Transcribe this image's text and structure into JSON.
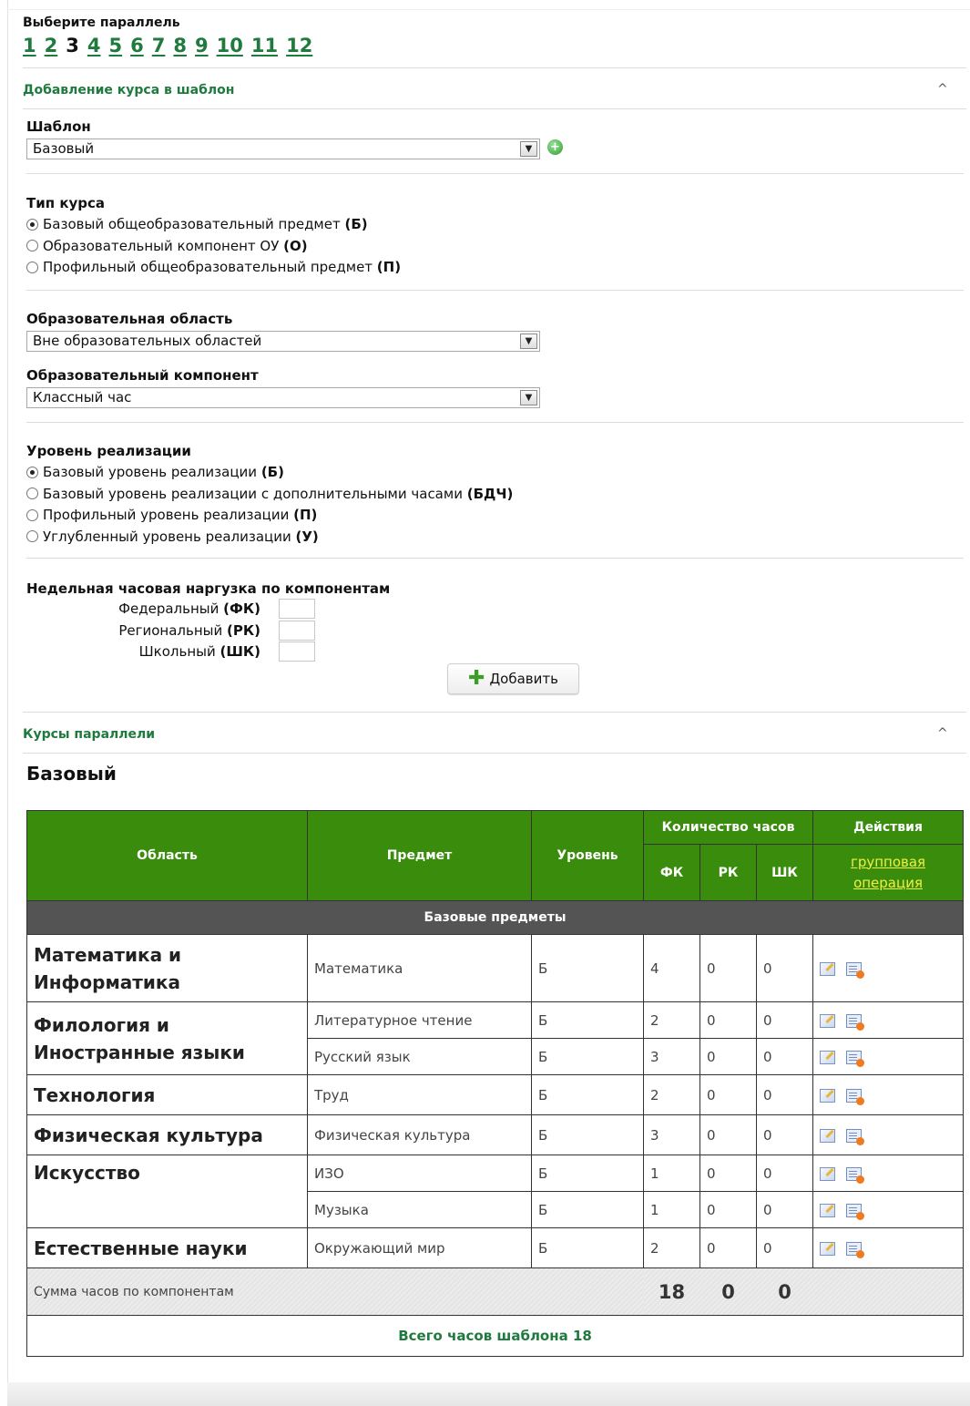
{
  "parallel": {
    "title": "Выберите параллель",
    "numbers": [
      "1",
      "2",
      "3",
      "4",
      "5",
      "6",
      "7",
      "8",
      "9",
      "10",
      "11",
      "12"
    ],
    "current": "3"
  },
  "add_section": {
    "title": "Добавление курса в шаблон",
    "template_label": "Шаблон",
    "template_value": "Базовый",
    "course_type_label": "Тип курса",
    "course_types": [
      {
        "text": "Базовый общеобразовательный предмет ",
        "code": "(Б)",
        "checked": true
      },
      {
        "text": "Образовательный компонент ОУ ",
        "code": "(О)",
        "checked": false
      },
      {
        "text": "Профильный общеобразовательный предмет ",
        "code": "(П)",
        "checked": false
      }
    ],
    "area_label": "Образовательная область",
    "area_value": "Вне образовательных областей",
    "component_label": "Образовательный компонент",
    "component_value": "Классный час",
    "level_label": "Уровень реализации",
    "levels": [
      {
        "text": "Базовый уровень реализации ",
        "code": "(Б)",
        "checked": true
      },
      {
        "text": "Базовый уровень реализации с дополнительными часами ",
        "code": "(БДЧ)",
        "checked": false
      },
      {
        "text": "Профильный уровень реализации ",
        "code": "(П)",
        "checked": false
      },
      {
        "text": "Углубленный уровень реализации ",
        "code": "(У)",
        "checked": false
      }
    ],
    "load_label": "Недельная часовая наргузка по компонентам",
    "load_rows": [
      {
        "text": "Федеральный ",
        "code": "(ФК)"
      },
      {
        "text": "Региональный ",
        "code": "(РК)"
      },
      {
        "text": "Школьный ",
        "code": "(ШК)"
      }
    ],
    "add_button": "Добавить"
  },
  "courses_section": {
    "title": "Курсы параллели",
    "template_name": "Базовый",
    "headers": {
      "area": "Область",
      "subject": "Предмет",
      "level": "Уровень",
      "hours": "Количество часов",
      "fk": "ФК",
      "rk": "РК",
      "shk": "ШК",
      "actions": "Действия",
      "group_op_1": "групповая",
      "group_op_2": "операция"
    },
    "group_title": "Базовые предметы",
    "areas": [
      {
        "name": "Математика и Информатика",
        "rows": [
          {
            "subject": "Математика",
            "level": "Б",
            "fk": "4",
            "rk": "0",
            "shk": "0"
          }
        ]
      },
      {
        "name": "Филология и Иностранные языки",
        "rows": [
          {
            "subject": "Литературное чтение",
            "level": "Б",
            "fk": "2",
            "rk": "0",
            "shk": "0"
          },
          {
            "subject": "Русский язык",
            "level": "Б",
            "fk": "3",
            "rk": "0",
            "shk": "0"
          }
        ]
      },
      {
        "name": "Технология",
        "rows": [
          {
            "subject": "Труд",
            "level": "Б",
            "fk": "2",
            "rk": "0",
            "shk": "0"
          }
        ]
      },
      {
        "name": "Физическая культура",
        "rows": [
          {
            "subject": "Физическая культура",
            "level": "Б",
            "fk": "3",
            "rk": "0",
            "shk": "0"
          }
        ]
      },
      {
        "name": "Искусство",
        "rows": [
          {
            "subject": "ИЗО",
            "level": "Б",
            "fk": "1",
            "rk": "0",
            "shk": "0"
          },
          {
            "subject": "Музыка",
            "level": "Б",
            "fk": "1",
            "rk": "0",
            "shk": "0"
          }
        ]
      },
      {
        "name": "Естественные науки",
        "rows": [
          {
            "subject": "Окружающий мир",
            "level": "Б",
            "fk": "2",
            "rk": "0",
            "shk": "0"
          }
        ]
      }
    ],
    "sum_label": "Сумма часов по компонентам",
    "sum_fk": "18",
    "sum_rk": "0",
    "sum_shk": "0",
    "total_label": "Всего часов шаблона 18"
  },
  "colors": {
    "accent_green": "#1f7a3e",
    "header_green": "#3a8c0c",
    "group_gray": "#545454",
    "link_yellow": "#f0f040"
  }
}
